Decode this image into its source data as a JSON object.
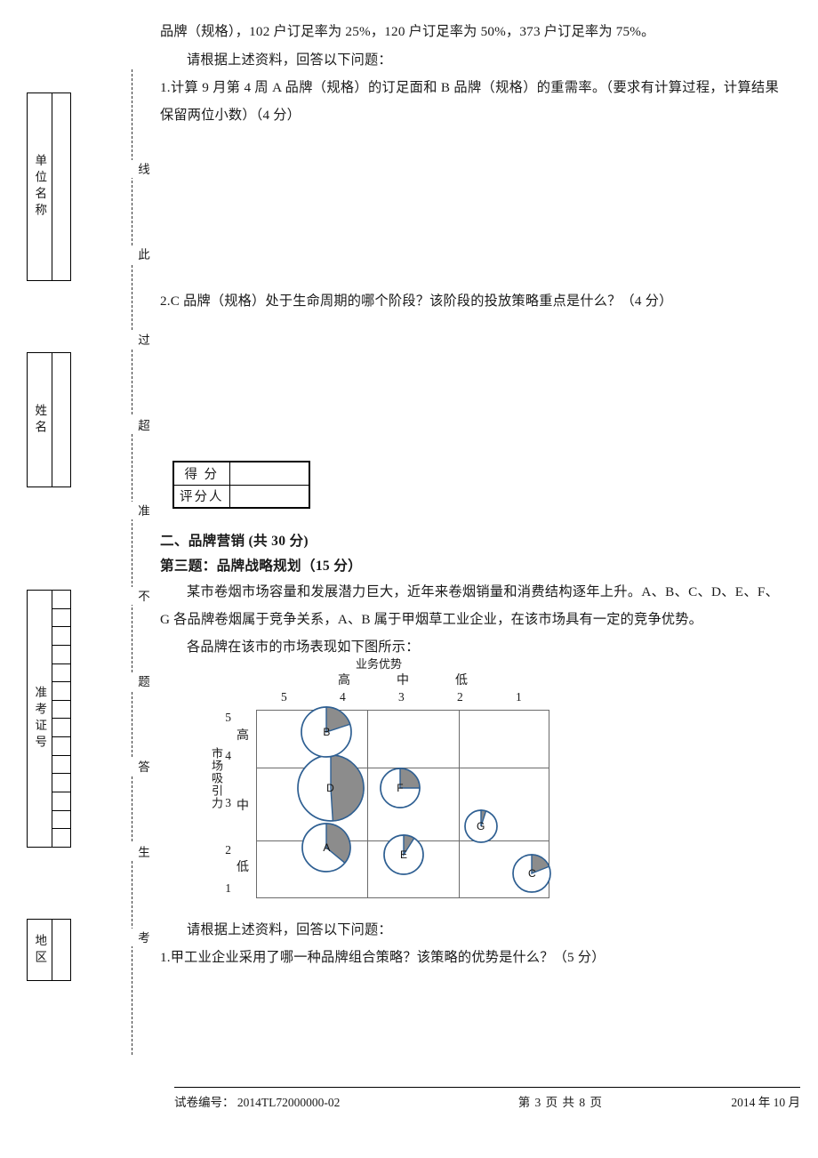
{
  "sidebar": {
    "boxes": [
      {
        "name": "unit-name",
        "label": "单位名称",
        "cells": 1
      },
      {
        "name": "student-name",
        "label": "姓名",
        "cells": 1
      },
      {
        "name": "exam-number",
        "label": "准考证号",
        "cells": 14
      },
      {
        "name": "region",
        "label": "地区",
        "cells": 1
      }
    ],
    "seal_line_chars": [
      "线",
      "此",
      "过",
      "超",
      "准",
      "不",
      "题",
      "答",
      "生",
      "考"
    ]
  },
  "body": {
    "line1": "品牌（规格），102 户订足率为 25%，120 户订足率为 50%，373 户订足率为 75%。",
    "line2": "请根据上述资料，回答以下问题：",
    "q1": "1.计算 9 月第 4 周 A 品牌（规格）的订足面和 B 品牌（规格）的重需率。（要求有计算过程，计算结果保留两位小数）（4 分）",
    "q2": "2.C 品牌（规格）处于生命周期的哪个阶段？该阶段的投放策略重点是什么？（4 分）",
    "section_heading": "二、品牌营销 (共 30 分)",
    "sub_heading": "第三题：品牌战略规划（15 分）",
    "para1": "某市卷烟市场容量和发展潜力巨大，近年来卷烟销量和消费结构逐年上升。A、B、C、D、E、F、G 各品牌卷烟属于竞争关系，A、B 属于甲烟草工业企业，在该市场具有一定的竞争优势。",
    "para2": "各品牌在该市的市场表现如下图所示：",
    "line3": "请根据上述资料，回答以下问题：",
    "q3": "1.甲工业企业采用了哪一种品牌组合策略？该策略的优势是什么？（5 分）"
  },
  "score_table": {
    "row1_label": "得  分",
    "row1_value": "",
    "row2_label": "评分人",
    "row2_value": ""
  },
  "chart_data": {
    "type": "scatter",
    "title": "业务优势",
    "xlabel": "业务优势",
    "ylabel": "市场吸引力",
    "x_tick_labels": [
      "5",
      "4",
      "3",
      "2",
      "1"
    ],
    "y_tick_labels": [
      "5",
      "4",
      "3",
      "2",
      "1"
    ],
    "x_category_labels": [
      "高",
      "中",
      "低"
    ],
    "y_category_labels": [
      "高",
      "中",
      "低"
    ],
    "xlim": [
      5,
      1
    ],
    "ylim": [
      1,
      5
    ],
    "grid": true,
    "note": "Pie-bubble matrix: bubble size = market volume, shaded wedge = market share",
    "points": [
      {
        "label": "A",
        "x": 4.05,
        "y": 2.1,
        "size": 54,
        "share_pct": 36
      },
      {
        "label": "B",
        "x": 4.05,
        "y": 4.55,
        "size": 56,
        "share_pct": 20
      },
      {
        "label": "C",
        "x": 1.25,
        "y": 1.55,
        "size": 42,
        "share_pct": 19
      },
      {
        "label": "D",
        "x": 4.0,
        "y": 3.35,
        "size": 74,
        "share_pct": 49
      },
      {
        "label": "E",
        "x": 3.0,
        "y": 1.95,
        "size": 44,
        "share_pct": 9
      },
      {
        "label": "F",
        "x": 3.05,
        "y": 3.35,
        "size": 44,
        "share_pct": 25
      },
      {
        "label": "G",
        "x": 1.95,
        "y": 2.55,
        "size": 36,
        "share_pct": 5
      }
    ],
    "colors": {
      "stroke": "#2e5f92",
      "wedge": "#8c8c8c",
      "grid": "#6b6b6b"
    }
  },
  "footer": {
    "paper_no": "试卷编号：  2014TL72000000-02",
    "page": "第 3 页 共 8 页",
    "date": "2014 年 10 月"
  }
}
